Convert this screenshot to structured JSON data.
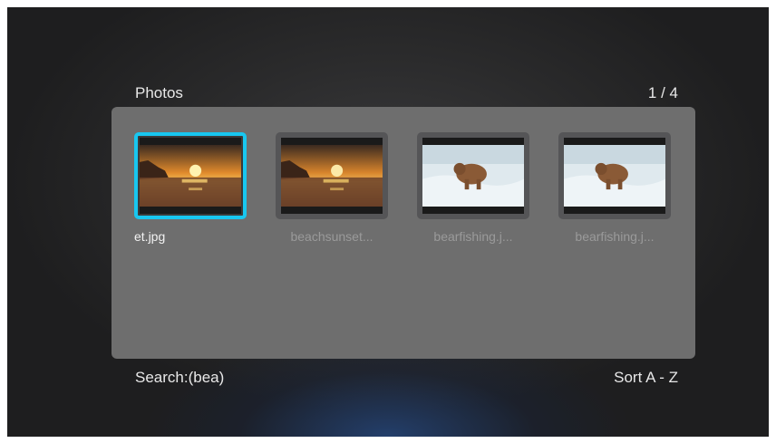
{
  "header": {
    "title": "Photos",
    "page_indicator": "1 / 4"
  },
  "grid": {
    "items": [
      {
        "caption": "et.jpg",
        "thumbnail": "sunset-beach",
        "selected": true
      },
      {
        "caption": "beachsunset...",
        "thumbnail": "sunset-beach",
        "selected": false
      },
      {
        "caption": "bearfishing.j...",
        "thumbnail": "bear-waterfall",
        "selected": false
      },
      {
        "caption": "bearfishing.j...",
        "thumbnail": "bear-waterfall",
        "selected": false
      }
    ]
  },
  "footer": {
    "search": "Search:(bea)",
    "sort": "Sort A - Z"
  },
  "colors": {
    "selection_accent": "#18c7f0",
    "panel": "#6e6e6e"
  }
}
